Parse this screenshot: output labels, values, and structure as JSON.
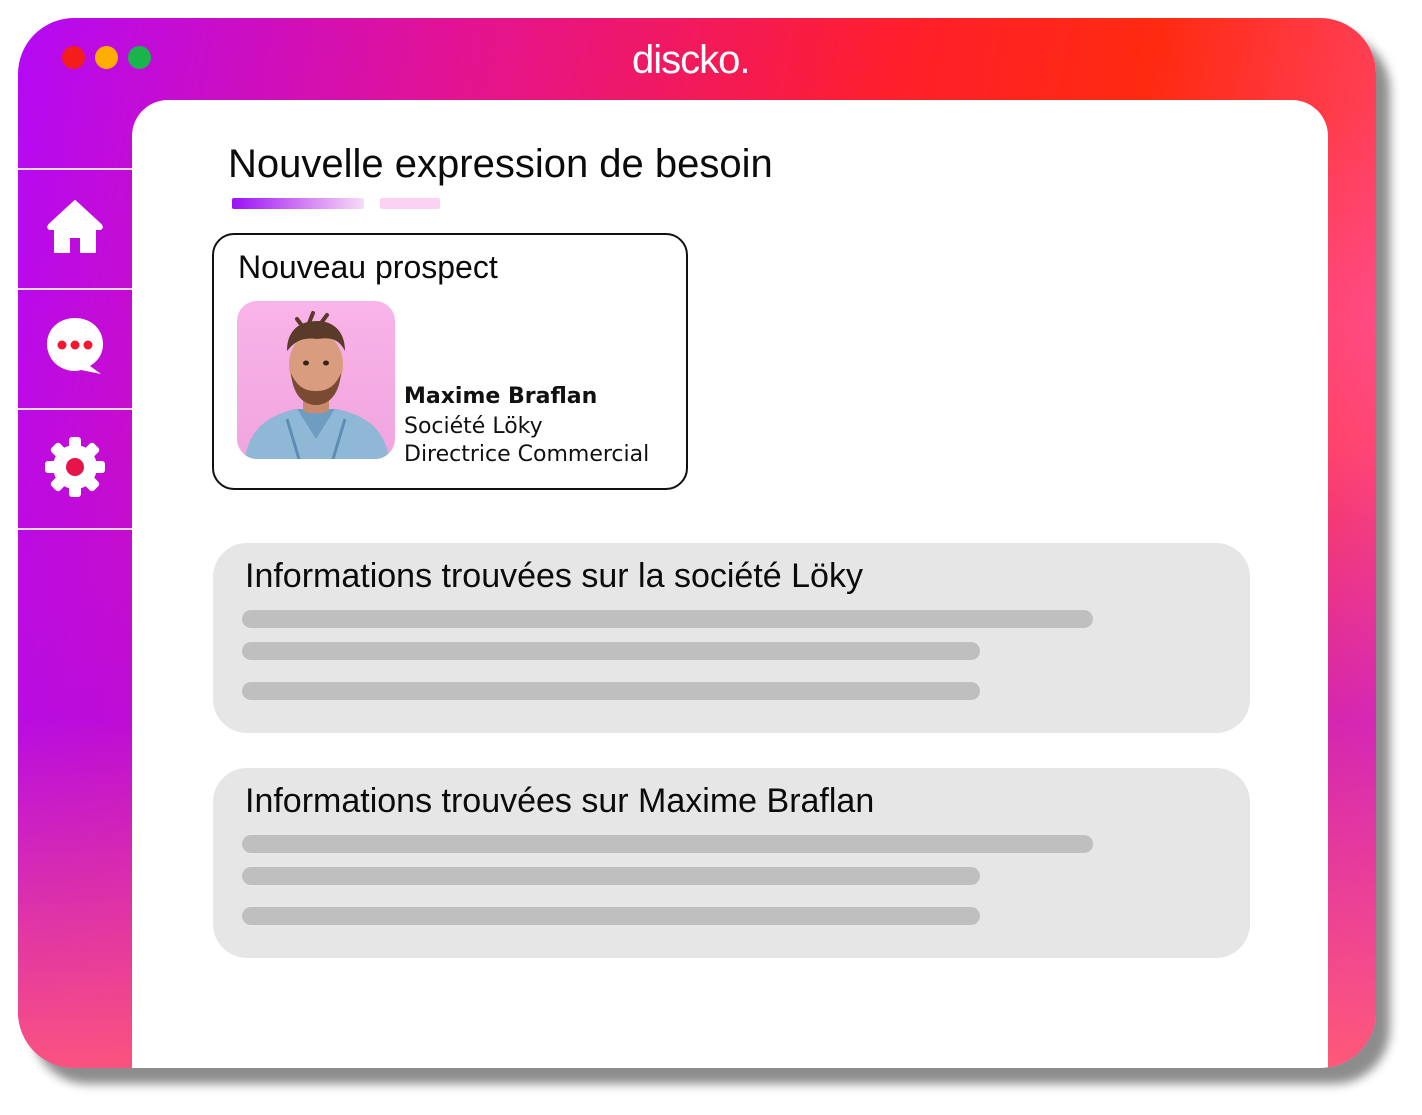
{
  "window": {
    "logo": "discko.",
    "controls": [
      "close",
      "minimize",
      "maximize"
    ]
  },
  "sidebar": {
    "items": [
      {
        "id": "home",
        "icon": "home-icon"
      },
      {
        "id": "chat",
        "icon": "chat-bubble-icon"
      },
      {
        "id": "settings",
        "icon": "gear-icon"
      }
    ]
  },
  "main": {
    "title": "Nouvelle expression de besoin",
    "steps_total": 2,
    "step_current": 1,
    "prospect_card": {
      "title": "Nouveau prospect",
      "name": "Maxime Braflan",
      "company": "Société Löky",
      "role": "Directrice Commercial"
    },
    "info_sections": [
      {
        "title": "Informations trouvées sur la société Löky",
        "placeholder_lines": 3
      },
      {
        "title": "Informations trouvées sur Maxime Braflan",
        "placeholder_lines": 3
      }
    ]
  },
  "colors": {
    "gradient_purple": "#b409f5",
    "gradient_red": "#ff1f2a",
    "gradient_pink": "#ff4f8c",
    "card_grey": "#e6e6e6",
    "placeholder_grey": "#bfbfbf",
    "avatar_bg": "#f9b4e9"
  }
}
